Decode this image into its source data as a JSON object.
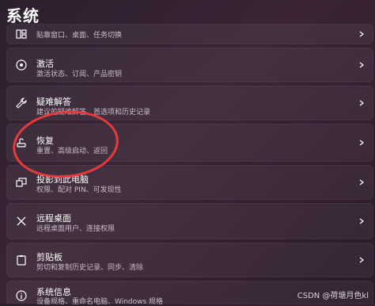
{
  "page": {
    "title": "系统"
  },
  "rows": [
    {
      "title": "",
      "subtitle": "贴靠窗口、桌面、任务切换",
      "icon": "multitasking-icon"
    },
    {
      "title": "激活",
      "subtitle": "激活状态、订阅、产品密钥",
      "icon": "activation-icon"
    },
    {
      "title": "疑难解答",
      "subtitle": "建议的疑难解答、首选项和历史记录",
      "icon": "wrench-icon"
    },
    {
      "title": "恢复",
      "subtitle": "重置、高级启动、返回",
      "icon": "recovery-icon"
    },
    {
      "title": "投影到此电脑",
      "subtitle": "权限、配对 PIN、可发现性",
      "icon": "projection-icon"
    },
    {
      "title": "远程桌面",
      "subtitle": "远程桌面用户、连接权限",
      "icon": "remote-desktop-icon"
    },
    {
      "title": "剪贴板",
      "subtitle": "剪切和复制历史记录、同步、清除",
      "icon": "clipboard-icon"
    },
    {
      "title": "系统信息",
      "subtitle": "设备规格、重命名电脑、Windows 规格",
      "icon": "info-icon"
    }
  ],
  "watermark": "CSDN @荷塘月色kl",
  "colors": {
    "highlight_circle": "#e83a3a"
  }
}
